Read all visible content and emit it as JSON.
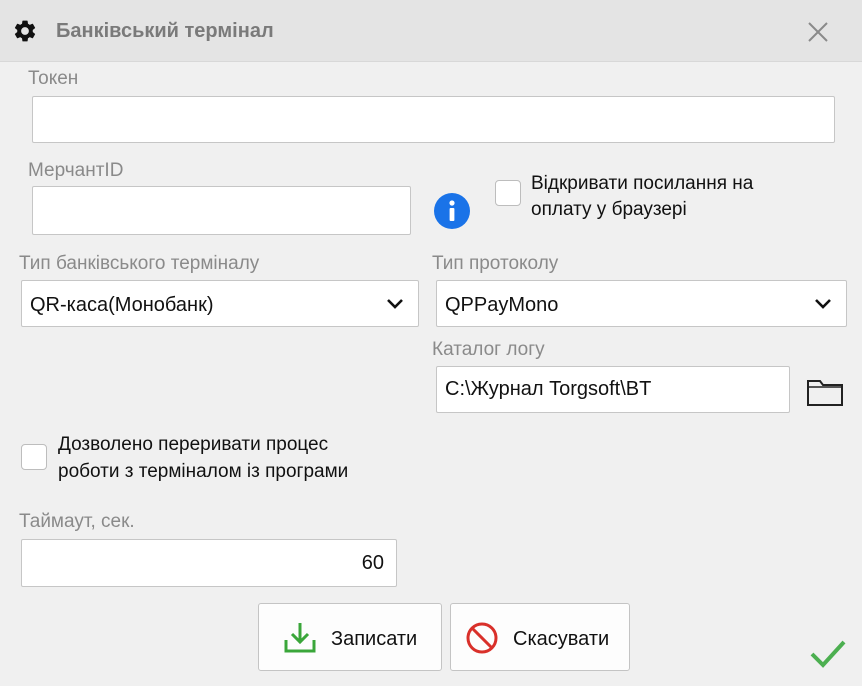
{
  "window": {
    "title": "Банківський термінал",
    "icon": "gear-icon",
    "close_icon": "close-icon"
  },
  "form": {
    "token": {
      "label": "Токен",
      "value": ""
    },
    "merchant_id": {
      "label": "МерчантID",
      "value": ""
    },
    "open_links": {
      "label_line1": "Відкривати посилання на",
      "label_line2": "оплату у браузері",
      "checked": false
    },
    "terminal_type": {
      "label": "Тип банківського терміналу",
      "value": "QR-каса(Монобанк)"
    },
    "protocol_type": {
      "label": "Тип протоколу",
      "value": "QPPayMono"
    },
    "log_dir": {
      "label": "Каталог логу",
      "value": "C:\\Журнал Torgsoft\\BT"
    },
    "allow_interrupt": {
      "label_line1": "Дозволено переривати процес",
      "label_line2": "роботи з терміналом із програми",
      "checked": false
    },
    "timeout": {
      "label": "Таймаут, сек.",
      "value": "60"
    }
  },
  "buttons": {
    "save": {
      "label": "Записати",
      "icon": "download-icon"
    },
    "cancel": {
      "label": "Скасувати",
      "icon": "prohibited-icon"
    }
  },
  "colors": {
    "info": "#1a73e8",
    "save_icon": "#3aa63a",
    "cancel_icon": "#d9302a",
    "confirm_check": "#4caf50"
  }
}
